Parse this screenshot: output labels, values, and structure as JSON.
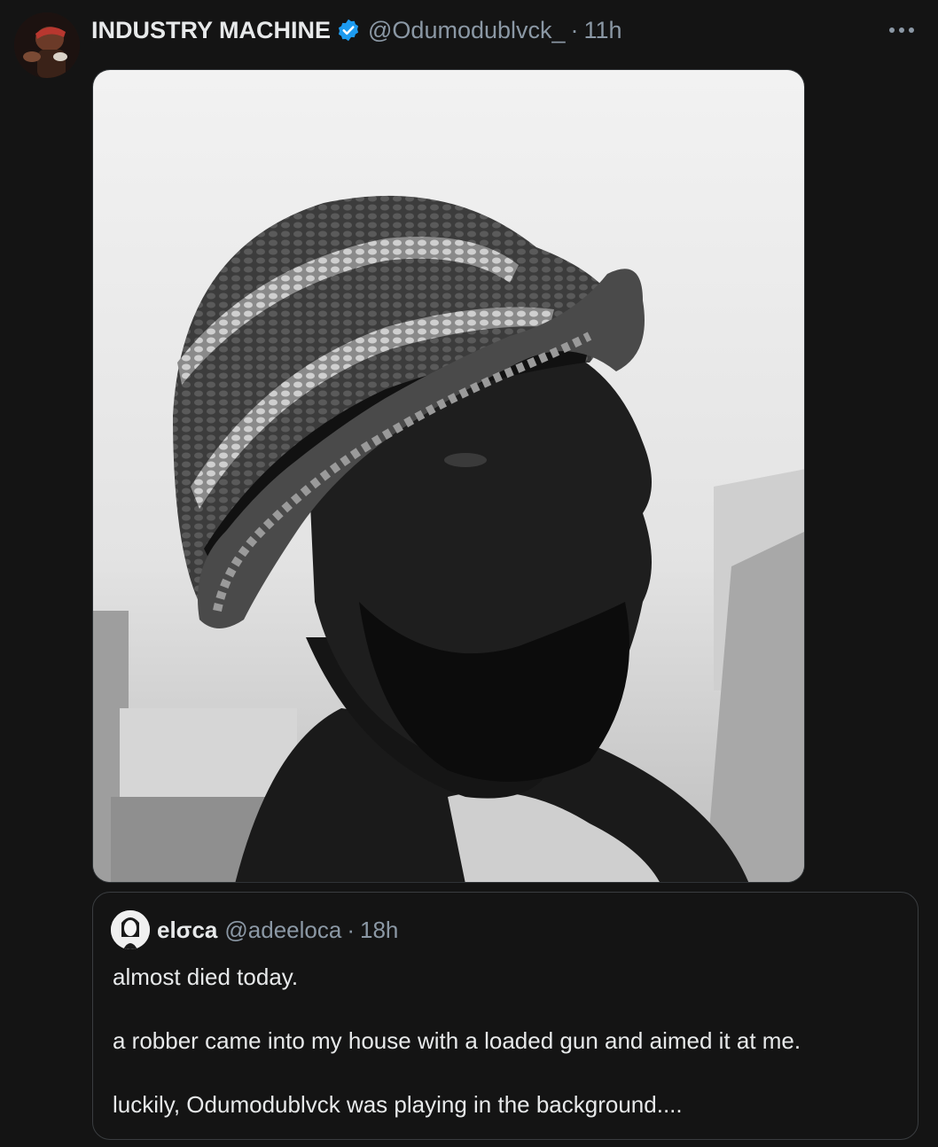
{
  "tweet": {
    "display_name": "INDUSTRY MACHINE",
    "handle": "@Odumodublvck_",
    "separator": "·",
    "time": "11h",
    "verified": true,
    "icons": {
      "verified": "verified-badge-icon",
      "more": "more-options-icon"
    },
    "colors": {
      "verified": "#1d9bf0",
      "background": "#141414",
      "muted": "#8b98a5"
    }
  },
  "quoted": {
    "display_name": "elσca",
    "handle": "@adeeloca",
    "separator": "·",
    "time": "18h",
    "lines": [
      "almost died today.",
      "a robber came into my house with a loaded gun and aimed it at me.",
      "luckily, Odumodublvck was playing in the background...."
    ]
  }
}
